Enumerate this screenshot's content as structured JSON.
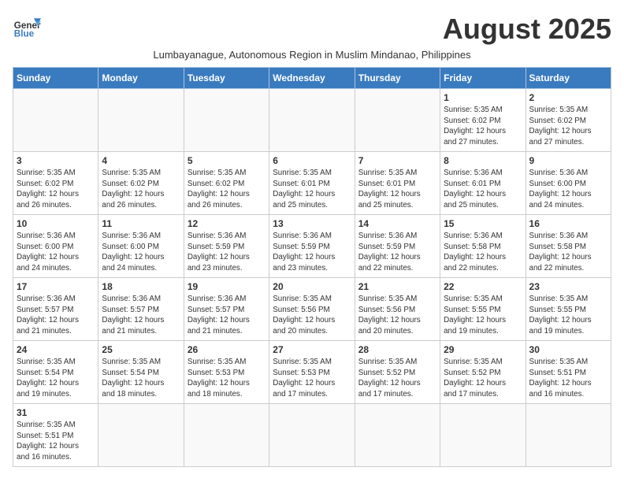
{
  "header": {
    "logo_line1": "General",
    "logo_line2": "Blue",
    "month_title": "August 2025",
    "subtitle": "Lumbayanague, Autonomous Region in Muslim Mindanao, Philippines"
  },
  "weekdays": [
    "Sunday",
    "Monday",
    "Tuesday",
    "Wednesday",
    "Thursday",
    "Friday",
    "Saturday"
  ],
  "weeks": [
    [
      {
        "day": "",
        "info": ""
      },
      {
        "day": "",
        "info": ""
      },
      {
        "day": "",
        "info": ""
      },
      {
        "day": "",
        "info": ""
      },
      {
        "day": "",
        "info": ""
      },
      {
        "day": "1",
        "info": "Sunrise: 5:35 AM\nSunset: 6:02 PM\nDaylight: 12 hours\nand 27 minutes."
      },
      {
        "day": "2",
        "info": "Sunrise: 5:35 AM\nSunset: 6:02 PM\nDaylight: 12 hours\nand 27 minutes."
      }
    ],
    [
      {
        "day": "3",
        "info": "Sunrise: 5:35 AM\nSunset: 6:02 PM\nDaylight: 12 hours\nand 26 minutes."
      },
      {
        "day": "4",
        "info": "Sunrise: 5:35 AM\nSunset: 6:02 PM\nDaylight: 12 hours\nand 26 minutes."
      },
      {
        "day": "5",
        "info": "Sunrise: 5:35 AM\nSunset: 6:02 PM\nDaylight: 12 hours\nand 26 minutes."
      },
      {
        "day": "6",
        "info": "Sunrise: 5:35 AM\nSunset: 6:01 PM\nDaylight: 12 hours\nand 25 minutes."
      },
      {
        "day": "7",
        "info": "Sunrise: 5:35 AM\nSunset: 6:01 PM\nDaylight: 12 hours\nand 25 minutes."
      },
      {
        "day": "8",
        "info": "Sunrise: 5:36 AM\nSunset: 6:01 PM\nDaylight: 12 hours\nand 25 minutes."
      },
      {
        "day": "9",
        "info": "Sunrise: 5:36 AM\nSunset: 6:00 PM\nDaylight: 12 hours\nand 24 minutes."
      }
    ],
    [
      {
        "day": "10",
        "info": "Sunrise: 5:36 AM\nSunset: 6:00 PM\nDaylight: 12 hours\nand 24 minutes."
      },
      {
        "day": "11",
        "info": "Sunrise: 5:36 AM\nSunset: 6:00 PM\nDaylight: 12 hours\nand 24 minutes."
      },
      {
        "day": "12",
        "info": "Sunrise: 5:36 AM\nSunset: 5:59 PM\nDaylight: 12 hours\nand 23 minutes."
      },
      {
        "day": "13",
        "info": "Sunrise: 5:36 AM\nSunset: 5:59 PM\nDaylight: 12 hours\nand 23 minutes."
      },
      {
        "day": "14",
        "info": "Sunrise: 5:36 AM\nSunset: 5:59 PM\nDaylight: 12 hours\nand 22 minutes."
      },
      {
        "day": "15",
        "info": "Sunrise: 5:36 AM\nSunset: 5:58 PM\nDaylight: 12 hours\nand 22 minutes."
      },
      {
        "day": "16",
        "info": "Sunrise: 5:36 AM\nSunset: 5:58 PM\nDaylight: 12 hours\nand 22 minutes."
      }
    ],
    [
      {
        "day": "17",
        "info": "Sunrise: 5:36 AM\nSunset: 5:57 PM\nDaylight: 12 hours\nand 21 minutes."
      },
      {
        "day": "18",
        "info": "Sunrise: 5:36 AM\nSunset: 5:57 PM\nDaylight: 12 hours\nand 21 minutes."
      },
      {
        "day": "19",
        "info": "Sunrise: 5:36 AM\nSunset: 5:57 PM\nDaylight: 12 hours\nand 21 minutes."
      },
      {
        "day": "20",
        "info": "Sunrise: 5:35 AM\nSunset: 5:56 PM\nDaylight: 12 hours\nand 20 minutes."
      },
      {
        "day": "21",
        "info": "Sunrise: 5:35 AM\nSunset: 5:56 PM\nDaylight: 12 hours\nand 20 minutes."
      },
      {
        "day": "22",
        "info": "Sunrise: 5:35 AM\nSunset: 5:55 PM\nDaylight: 12 hours\nand 19 minutes."
      },
      {
        "day": "23",
        "info": "Sunrise: 5:35 AM\nSunset: 5:55 PM\nDaylight: 12 hours\nand 19 minutes."
      }
    ],
    [
      {
        "day": "24",
        "info": "Sunrise: 5:35 AM\nSunset: 5:54 PM\nDaylight: 12 hours\nand 19 minutes."
      },
      {
        "day": "25",
        "info": "Sunrise: 5:35 AM\nSunset: 5:54 PM\nDaylight: 12 hours\nand 18 minutes."
      },
      {
        "day": "26",
        "info": "Sunrise: 5:35 AM\nSunset: 5:53 PM\nDaylight: 12 hours\nand 18 minutes."
      },
      {
        "day": "27",
        "info": "Sunrise: 5:35 AM\nSunset: 5:53 PM\nDaylight: 12 hours\nand 17 minutes."
      },
      {
        "day": "28",
        "info": "Sunrise: 5:35 AM\nSunset: 5:52 PM\nDaylight: 12 hours\nand 17 minutes."
      },
      {
        "day": "29",
        "info": "Sunrise: 5:35 AM\nSunset: 5:52 PM\nDaylight: 12 hours\nand 17 minutes."
      },
      {
        "day": "30",
        "info": "Sunrise: 5:35 AM\nSunset: 5:51 PM\nDaylight: 12 hours\nand 16 minutes."
      }
    ],
    [
      {
        "day": "31",
        "info": "Sunrise: 5:35 AM\nSunset: 5:51 PM\nDaylight: 12 hours\nand 16 minutes."
      },
      {
        "day": "",
        "info": ""
      },
      {
        "day": "",
        "info": ""
      },
      {
        "day": "",
        "info": ""
      },
      {
        "day": "",
        "info": ""
      },
      {
        "day": "",
        "info": ""
      },
      {
        "day": "",
        "info": ""
      }
    ]
  ]
}
